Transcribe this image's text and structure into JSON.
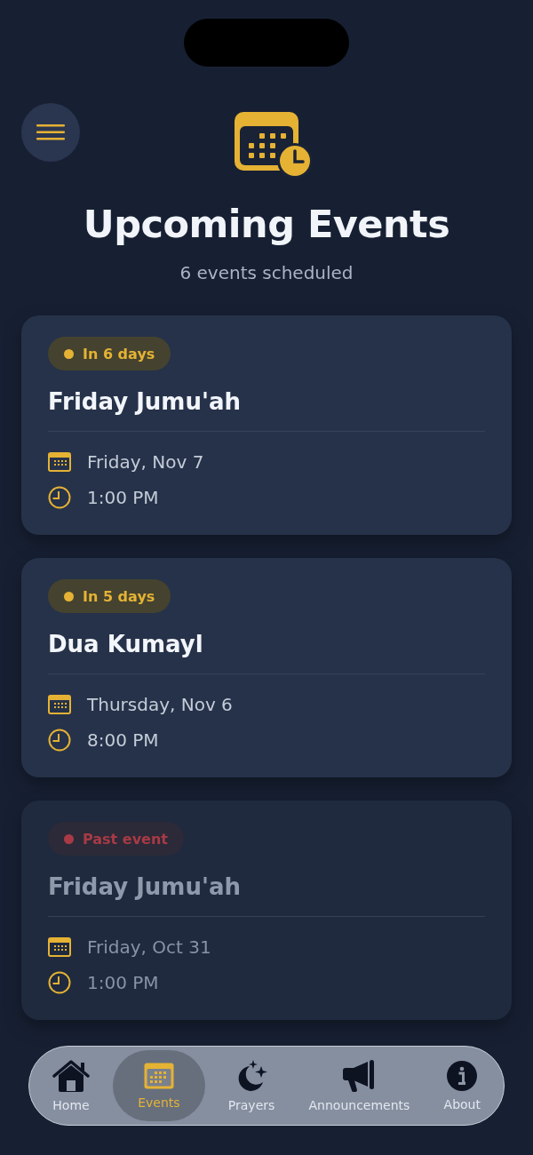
{
  "header": {
    "title": "Upcoming Events",
    "subtitle": "6 events scheduled"
  },
  "events": [
    {
      "badge": "In 6 days",
      "past": false,
      "title": "Friday Jumu'ah",
      "date": "Friday, Nov 7",
      "time": "1:00 PM"
    },
    {
      "badge": "In 5 days",
      "past": false,
      "title": "Dua Kumayl",
      "date": "Thursday, Nov 6",
      "time": "8:00 PM"
    },
    {
      "badge": "Past event",
      "past": true,
      "title": "Friday Jumu'ah",
      "date": "Friday, Oct 31",
      "time": "1:00 PM"
    }
  ],
  "tab_bar": [
    {
      "label": "Home",
      "selected": false
    },
    {
      "label": "Events",
      "selected": true
    },
    {
      "label": "Prayers",
      "selected": false
    },
    {
      "label": "Announcements",
      "selected": false
    },
    {
      "label": "About",
      "selected": false
    }
  ]
}
